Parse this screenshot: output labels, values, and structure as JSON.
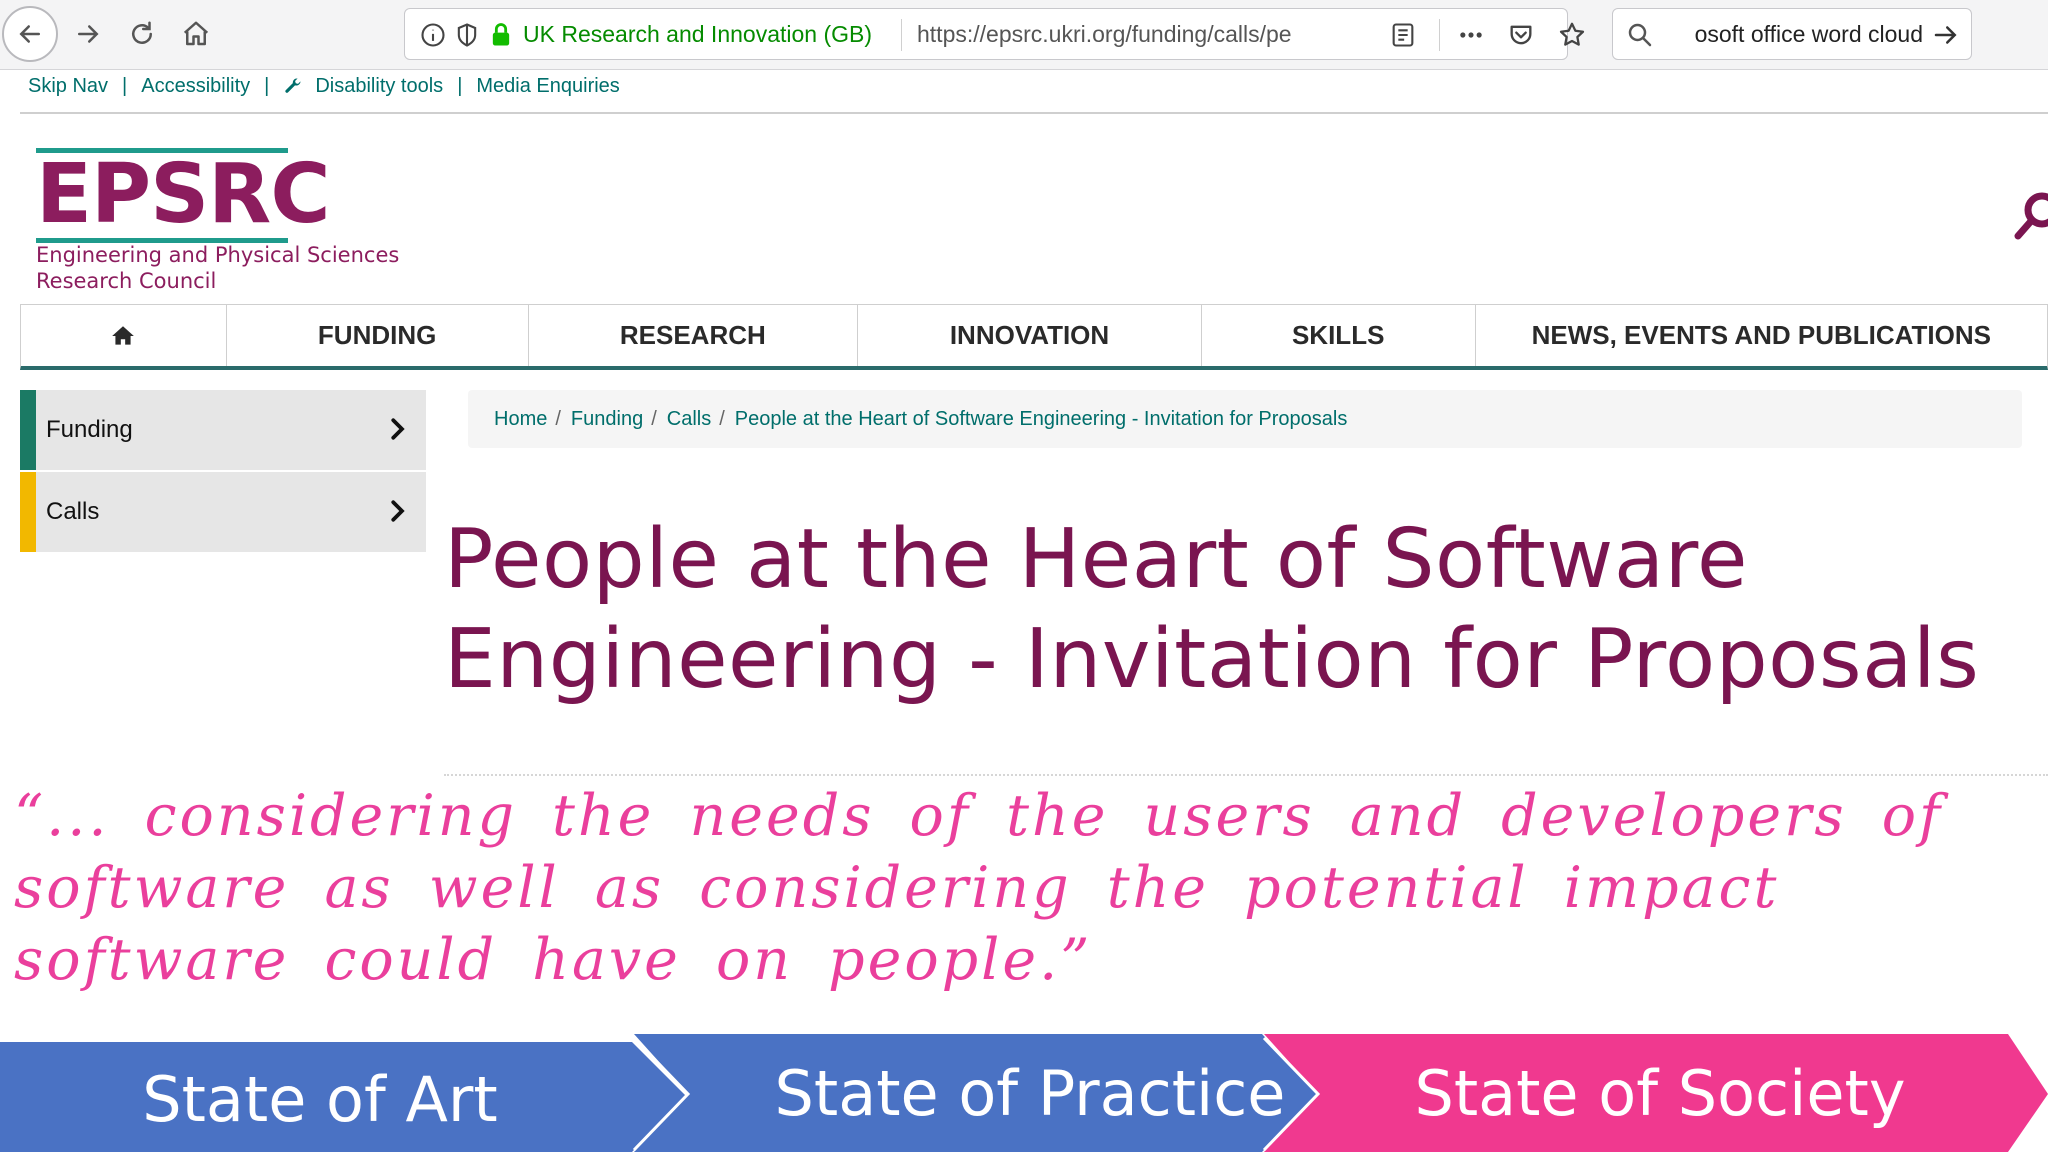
{
  "browser": {
    "site_identity": "UK Research and Innovation (GB)",
    "url": "https://epsrc.ukri.org/funding/calls/pe",
    "search_value": "osoft office word cloud"
  },
  "skiplinks": [
    "Skip Nav",
    "Accessibility",
    "Disability tools",
    "Media Enquiries"
  ],
  "logo": {
    "wordmark": "EPSRC",
    "line1": "Engineering and Physical Sciences",
    "line2": "Research Council",
    "color": "#8c1d5e"
  },
  "mainnav": [
    "FUNDING",
    "RESEARCH",
    "INNOVATION",
    "SKILLS",
    "NEWS, EVENTS AND PUBLICATIONS"
  ],
  "sidemenu": [
    {
      "label": "Funding",
      "accent": "#1b7a64"
    },
    {
      "label": "Calls",
      "accent": "#f2b800"
    }
  ],
  "breadcrumb": [
    "Home",
    "Funding",
    "Calls",
    "People at the Heart of Software Engineering - Invitation for Proposals"
  ],
  "page_title_line1": "People at the Heart of Software",
  "page_title_line2": "Engineering - Invitation for Proposals",
  "quote": "“... considering the needs of the users and developers of software as well as considering the potential impact software could have on people.”",
  "stages": [
    {
      "label": "State of Art",
      "color": "#4a72c4"
    },
    {
      "label": "State of Practice",
      "color": "#4a72c4"
    },
    {
      "label": "State of Society",
      "color": "#f0398f"
    }
  ],
  "icons": [
    "back-icon",
    "forward-icon",
    "reload-icon",
    "home-icon",
    "info-icon",
    "tracking-shield-icon",
    "lock-icon",
    "reader-view-icon",
    "more-icon",
    "pocket-icon",
    "bookmark-star-icon",
    "search-icon",
    "arrow-right-icon",
    "wrench-icon",
    "site-search-icon",
    "chevron-right-icon"
  ]
}
